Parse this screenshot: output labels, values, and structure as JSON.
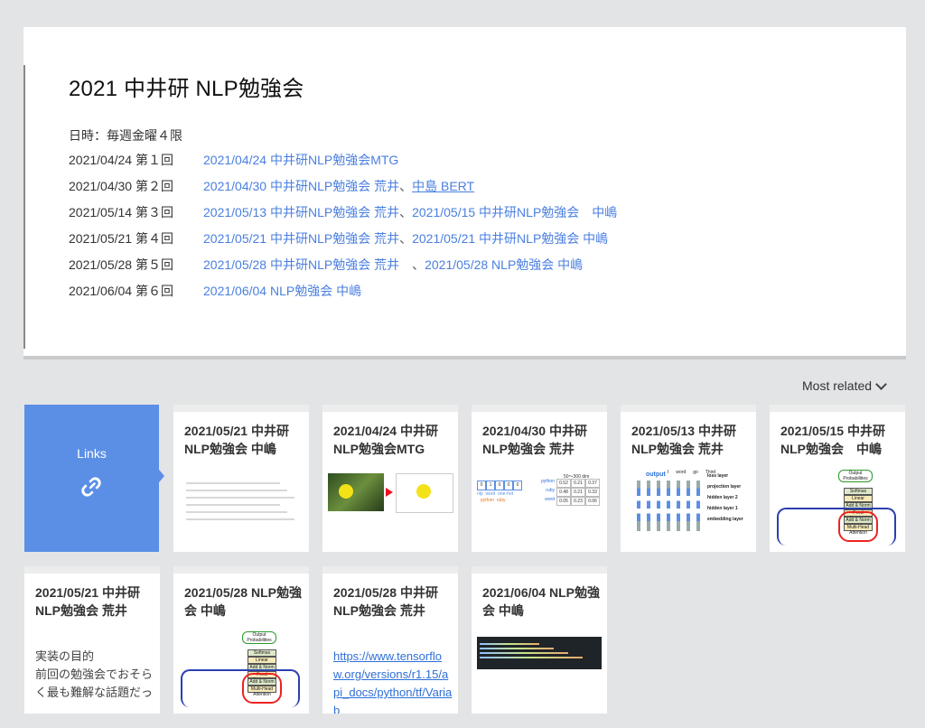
{
  "page": {
    "title": "2021 中井研 NLP勉強会",
    "schedule": "日時：毎週金曜４限"
  },
  "sessions": [
    {
      "date": "2021/04/24 第１回",
      "links": [
        "2021/04/24 中井研NLP勉強会MTG"
      ]
    },
    {
      "date": "2021/04/30 第２回",
      "links": [
        "2021/04/30 中井研NLP勉強会 荒井",
        "中島 BERT"
      ]
    },
    {
      "date": "2021/05/14 第３回",
      "links": [
        "2021/05/13 中井研NLP勉強会 荒井",
        "2021/05/15 中井研NLP勉強会　中嶋"
      ]
    },
    {
      "date": "2021/05/21 第４回",
      "links": [
        "2021/05/21 中井研NLP勉強会 荒井",
        "2021/05/21 中井研NLP勉強会 中嶋"
      ]
    },
    {
      "date": "2021/05/28 第５回",
      "links": [
        "2021/05/28 中井研NLP勉強会 荒井　",
        "2021/05/28 NLP勉強会 中嶋"
      ]
    },
    {
      "date": "2021/06/04 第６回",
      "links": [
        "2021/06/04 NLP勉強会 中嶋"
      ]
    }
  ],
  "separator": "、",
  "sort": {
    "label": "Most related"
  },
  "links_card": {
    "label": "Links",
    "icon": "link-icon"
  },
  "cards": [
    {
      "title": "2021/05/21 中井研NLP勉強会 中嶋",
      "thumb": "text-lines"
    },
    {
      "title": "2021/04/24 中井研NLP勉強会MTG",
      "thumb": "photo-smiley"
    },
    {
      "title": "2021/04/30 中井研NLP勉強会 荒井",
      "thumb": "onehot-table"
    },
    {
      "title": "2021/05/13 中井研NLP勉強会 荒井",
      "thumb": "rnn-layers"
    },
    {
      "title": "2021/05/15 中井研NLP勉強会　中嶋",
      "thumb": "transformer"
    },
    {
      "title": "2021/05/21 中井研NLP勉強会 荒井",
      "excerpt": "実装の目的\n前回の勉強会でおそらく最も難解な話題だっ"
    },
    {
      "title": "2021/05/28 NLP勉強会 中嶋",
      "thumb": "transformer"
    },
    {
      "title": "2021/05/28 中井研NLP勉強会 荒井",
      "url": "https://www.tensorflow.org/versions/r1.15/api_docs/python/tf/Variab"
    },
    {
      "title": "2021/06/04 NLP勉強会 中嶋",
      "thumb": "code"
    }
  ],
  "thumb_text": {
    "onehot": {
      "digits": [
        "0",
        "1",
        "0",
        "0",
        "0"
      ],
      "labels": [
        "nlp",
        "word",
        "one-hot"
      ],
      "colored": [
        "python",
        "ruby"
      ],
      "dim": "50～300 dim",
      "rows": [
        {
          "name": "python",
          "vals": [
            "0.52",
            "0.21",
            "0.37"
          ]
        },
        {
          "name": "ruby",
          "vals": [
            "0.48",
            "0.21",
            "0.33"
          ]
        },
        {
          "name": "word",
          "vals": [
            "0.05",
            "0.23",
            "0.06"
          ]
        }
      ]
    },
    "rnn": {
      "output": "output",
      "tops": [
        "I",
        "word",
        "go",
        "Third"
      ],
      "layers": [
        "loss layer",
        "projection layer",
        "hidden layer 2",
        "hidden layer 1",
        "embedding layer"
      ]
    },
    "transformer": {
      "labels": [
        "Output Probabilities",
        "Softmax",
        "Linear",
        "Add & Norm",
        "Feed Forward",
        "Add & Norm",
        "Multi-Head Attention"
      ]
    }
  },
  "colors": {
    "link": "#4a7fe0",
    "accent": "#5b8fe6",
    "page_bg": "#e3e4e6"
  }
}
